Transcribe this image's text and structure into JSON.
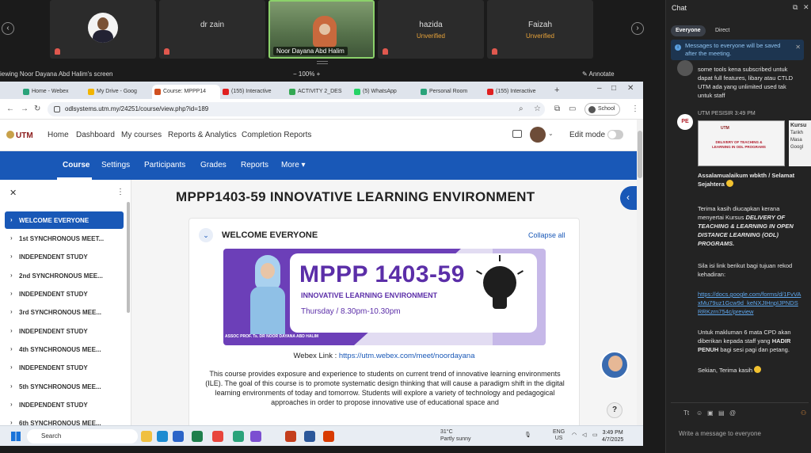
{
  "participants": [
    {
      "name": "",
      "status": "",
      "type": "avatar"
    },
    {
      "name": "dr zain",
      "status": "",
      "type": "blank"
    },
    {
      "name": "Noor Dayana Abd Halim",
      "status": "",
      "type": "video"
    },
    {
      "name": "hazida",
      "status": "Unverified",
      "type": "blank"
    },
    {
      "name": "Faizah",
      "status": "Unverified",
      "type": "blank"
    }
  ],
  "share": {
    "label": "iewing Noor Dayana Abd Halim's screen",
    "zoom": "100%",
    "annotate": "Annotate"
  },
  "browser": {
    "tabs": [
      {
        "label": "Home - Webex",
        "color": "#2aa37a"
      },
      {
        "label": "My Drive - Goog",
        "color": "#f2b400"
      },
      {
        "label": "Course: MPPP14",
        "color": "#d05020"
      },
      {
        "label": "(155) Interactive",
        "color": "#e02020"
      },
      {
        "label": "ACTIVITY 2_DES",
        "color": "#34a853"
      },
      {
        "label": "(5) WhatsApp",
        "color": "#25d366"
      },
      {
        "label": "Personal Room",
        "color": "#2aa37a"
      },
      {
        "label": "(155) Interactive",
        "color": "#e02020"
      }
    ],
    "url": "odlsystems.utm.my/24251/course/view.php?id=189",
    "profile": "School"
  },
  "moodle": {
    "logo": "UTM",
    "nav": [
      "Home",
      "Dashboard",
      "My courses",
      "Reports & Analytics",
      "Completion Reports"
    ],
    "edit_mode": "Edit mode",
    "course_nav": [
      "Course",
      "Settings",
      "Participants",
      "Grades",
      "Reports",
      "More ▾"
    ],
    "sections": [
      "WELCOME EVERYONE",
      "1st SYNCHRONOUS MEET...",
      "INDEPENDENT STUDY",
      "2nd SYNCHRONOUS MEE...",
      "INDEPENDENT STUDY",
      "3rd SYNCHRONOUS MEE...",
      "INDEPENDENT STUDY",
      "4th SYNCHRONOUS MEE...",
      "INDEPENDENT STUDY",
      "5th SYNCHRONOUS MEE...",
      "INDEPENDENT STUDY",
      "6th SYNCHRONOUS MEE..."
    ],
    "course_title": "MPPP1403-59 INNOVATIVE LEARNING ENVIRONMENT",
    "section_title": "WELCOME EVERYONE",
    "collapse_all": "Collapse all",
    "banner": {
      "code": "MPPP 1403-59",
      "subtitle": "INNOVATIVE LEARNING ENVIRONMENT",
      "time": "Thursday / 8.30pm-10.30pm",
      "credit": "ASSOC PROF. Ts. DR NOOR DAYANA ABD HALIM"
    },
    "webex_label": "Webex Link : ",
    "webex_url": "https://utm.webex.com/meet/noordayana",
    "description": "This course provides exposure and experience to students on current trend of innovative learning environments (ILE). The goal of this course is to promote systematic design thinking that will cause a paradigm shift in the digital learning environments of today and tomorrow. Students will explore a variety of technology and pedagogical approaches in order to propose innovative use of educational space and"
  },
  "taskbar": {
    "search": "Search",
    "weather_temp": "31°C",
    "weather_desc": "Partly sunny",
    "lang": "ENG",
    "region": "US",
    "time": "3:49 PM",
    "date": "4/7/2025"
  },
  "chat": {
    "title": "Chat",
    "tabs": [
      "Everyone",
      "Direct"
    ],
    "notice": "Messages to everyone will be saved after the meeting.",
    "msg1": "some tools kena subscribed untuk dapat full features, libary atau CTLD UTM ada yang unlimited used tak untuk staff",
    "sender": "UTM PESISIR   3:49 PM",
    "poster_title": "DELIVERY OF TEACHING & LEARNING IN ODL PROGRAMS",
    "poster_logo": "UTM",
    "poster_cap": [
      "Kursu",
      "Tarikh",
      "Masa",
      "Googl"
    ],
    "greet": "Assalamualaikum wbkth / Selamat Sejahtera",
    "thanks_pre": "Terima kasih diucapkan kerana menyertai Kursus ",
    "thanks_bold": "DELIVERY OF TEACHING & LEARNING IN OPEN DISTANCE LEARNING (ODL) PROGRAMS.",
    "link_intro": "Sila isi link berikut bagi tujuan rekod kehadiran:",
    "link": "https://docs.google.com/forms/d/1FvVAxMu79uz1Gcw9d_keNXJIHnpIJPNDSRRKzrn754c/preview",
    "cpd_pre": "Untuk makluman 6 mata CPD akan diberikan kepada staff yang ",
    "cpd_bold": "HADIR PENUH",
    "cpd_post": " bagi sesi pagi dan petang.",
    "closing": "Sekian, Terima kasih",
    "placeholder": "Write a message to everyone"
  }
}
